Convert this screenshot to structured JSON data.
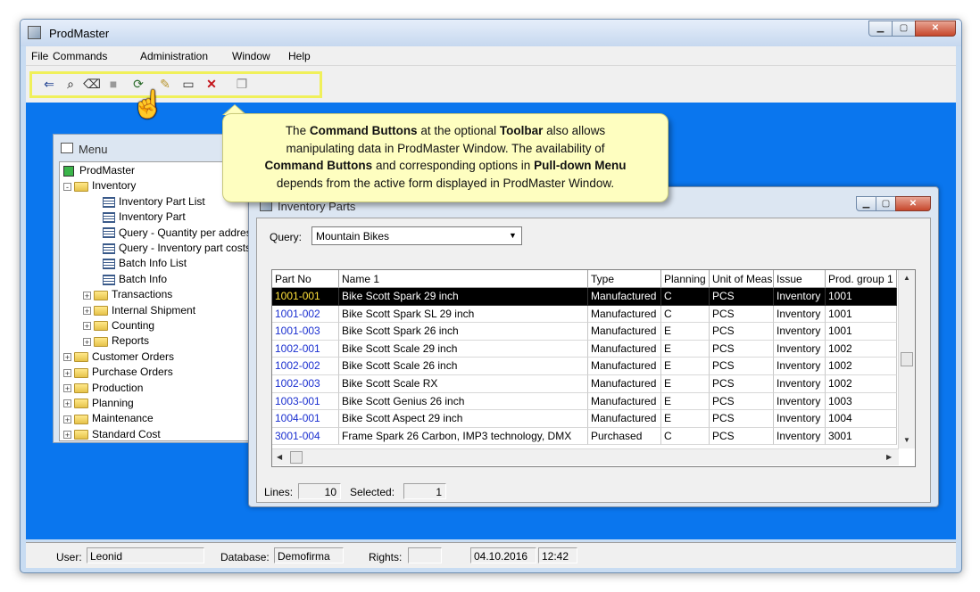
{
  "app": {
    "title": "ProdMaster"
  },
  "menubar": [
    {
      "label": "File"
    },
    {
      "label": "Commands"
    },
    {
      "label": "Administration"
    },
    {
      "label": "Window"
    },
    {
      "label": "Help"
    }
  ],
  "toolbar": {
    "buttons": [
      {
        "icon": "import-icon"
      },
      {
        "icon": "find-icon"
      },
      {
        "icon": "eraser-icon"
      },
      {
        "icon": "stop-icon"
      },
      {
        "icon": "refresh-icon"
      },
      {
        "icon": "new-icon"
      },
      {
        "icon": "window-icon"
      },
      {
        "icon": "delete-icon"
      },
      {
        "icon": "copy-icon"
      }
    ],
    "highlight_color": "#f0f05a"
  },
  "callout": {
    "line1": "The ",
    "b1": "Command Buttons",
    "line1b": " at the optional ",
    "b2": "Toolbar",
    "line1c": " also allows",
    "line2": "manipulating data in ProdMaster Window.  The availability of",
    "b3": "Command Buttons",
    "line3b": " and corresponding options in ",
    "b4": "Pull-down Menu",
    "line4": "depends from the active form displayed in ProdMaster Window."
  },
  "menu_window": {
    "title": "Menu",
    "tree": [
      {
        "label": "ProdMaster",
        "kind": "root",
        "indent": 0
      },
      {
        "label": "Inventory",
        "kind": "folder",
        "indent": 1,
        "toggle": "-"
      },
      {
        "label": "Inventory Part List",
        "kind": "form",
        "indent": 2
      },
      {
        "label": "Inventory Part",
        "kind": "form",
        "indent": 2
      },
      {
        "label": "Query - Quantity per addres",
        "kind": "form",
        "indent": 2
      },
      {
        "label": "Query - Inventory part costs",
        "kind": "form",
        "indent": 2
      },
      {
        "label": "Batch Info List",
        "kind": "form",
        "indent": 2
      },
      {
        "label": "Batch Info",
        "kind": "form",
        "indent": 2
      },
      {
        "label": "Transactions",
        "kind": "folder",
        "indent": 2,
        "toggle": "+"
      },
      {
        "label": "Internal Shipment",
        "kind": "folder",
        "indent": 2,
        "toggle": "+"
      },
      {
        "label": "Counting",
        "kind": "folder",
        "indent": 2,
        "toggle": "+"
      },
      {
        "label": "Reports",
        "kind": "folder",
        "indent": 2,
        "toggle": "+"
      },
      {
        "label": "Customer Orders",
        "kind": "folder",
        "indent": 1,
        "toggle": "+"
      },
      {
        "label": "Purchase Orders",
        "kind": "folder",
        "indent": 1,
        "toggle": "+"
      },
      {
        "label": "Production",
        "kind": "folder",
        "indent": 1,
        "toggle": "+"
      },
      {
        "label": "Planning",
        "kind": "folder",
        "indent": 1,
        "toggle": "+"
      },
      {
        "label": "Maintenance",
        "kind": "folder",
        "indent": 1,
        "toggle": "+"
      },
      {
        "label": "Standard Cost",
        "kind": "folder",
        "indent": 1,
        "toggle": "+"
      }
    ]
  },
  "inventory_window": {
    "title": "Inventory Parts",
    "query_label": "Query:",
    "query_value": "Mountain Bikes",
    "columns": [
      "Part No",
      "Name 1",
      "Type",
      "Planning",
      "Unit of Meas",
      "Issue",
      "Prod. group 1"
    ],
    "rows": [
      [
        "1001-001",
        "Bike Scott Spark 29 inch",
        "Manufactured",
        "C",
        "PCS",
        "Inventory",
        "1001"
      ],
      [
        "1001-002",
        "Bike Scott Spark SL 29 inch",
        "Manufactured",
        "C",
        "PCS",
        "Inventory",
        "1001"
      ],
      [
        "1001-003",
        "Bike Scott Spark 26 inch",
        "Manufactured",
        "E",
        "PCS",
        "Inventory",
        "1001"
      ],
      [
        "1002-001",
        "Bike Scott Scale 29 inch",
        "Manufactured",
        "E",
        "PCS",
        "Inventory",
        "1002"
      ],
      [
        "1002-002",
        "Bike Scott Scale 26 inch",
        "Manufactured",
        "E",
        "PCS",
        "Inventory",
        "1002"
      ],
      [
        "1002-003",
        "Bike Scott Scale RX",
        "Manufactured",
        "E",
        "PCS",
        "Inventory",
        "1002"
      ],
      [
        "1003-001",
        "Bike Scott Genius 26 inch",
        "Manufactured",
        "E",
        "PCS",
        "Inventory",
        "1003"
      ],
      [
        "1004-001",
        "Bike Scott Aspect 29 inch",
        "Manufactured",
        "E",
        "PCS",
        "Inventory",
        "1004"
      ],
      [
        "3001-004",
        "Frame Spark 26 Carbon, IMP3 technology, DMX",
        "Purchased",
        "C",
        "PCS",
        "Inventory",
        "3001"
      ]
    ],
    "selected_row": 0,
    "lines_label": "Lines:",
    "lines_value": "10",
    "selected_label": "Selected:",
    "selected_value": "1"
  },
  "statusbar": {
    "user_label": "User:",
    "user_value": "Leonid",
    "database_label": "Database:",
    "database_value": "Demofirma",
    "rights_label": "Rights:",
    "rights_value": "",
    "date": "04.10.2016",
    "time": "12:42"
  },
  "colors": {
    "mdi_background": "#0a76ee",
    "callout_background": "#fefec0",
    "part_no_link": "#1a2fd0",
    "selected_row": "#000000"
  }
}
